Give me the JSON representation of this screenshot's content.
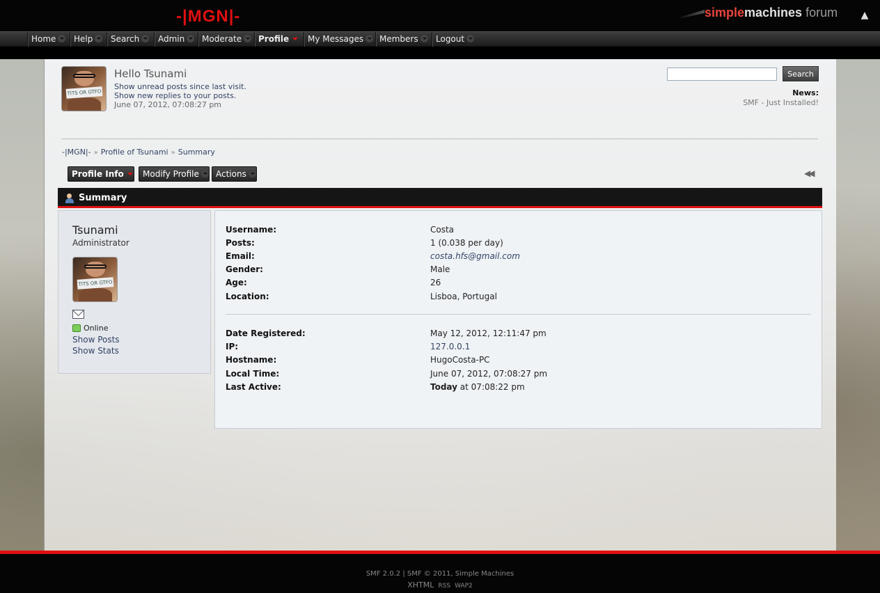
{
  "site": {
    "title": "-|MGN|-"
  },
  "brand": {
    "simple": "simple",
    "machines": "machines",
    "forum": " forum"
  },
  "menu": {
    "items": [
      "Home",
      "Help",
      "Search",
      "Admin",
      "Moderate",
      "Profile",
      "My Messages",
      "Members",
      "Logout"
    ],
    "active": "Profile"
  },
  "user": {
    "hello": "Hello Tsunami",
    "unread": "Show unread posts since last visit.",
    "replies": "Show new replies to your posts.",
    "date": "June 07, 2012, 07:08:27 pm"
  },
  "search": {
    "value": "",
    "button": "Search"
  },
  "news": {
    "label": "News:",
    "text": "SMF - Just Installed!"
  },
  "breadcrumb": [
    "-|MGN|-",
    "Profile of Tsunami",
    "Summary"
  ],
  "tabs": [
    "Profile Info",
    "Modify Profile",
    "Actions"
  ],
  "section": {
    "title": "Summary"
  },
  "profile": {
    "name": "Tsunami",
    "position": "Administrator",
    "avatar_sign": "TITS OR GTFO",
    "online_label": "Online",
    "show_posts": "Show Posts",
    "show_stats": "Show Stats",
    "fields1": [
      {
        "k": "Username:",
        "v": "Costa"
      },
      {
        "k": "Posts:",
        "v": "1 (0.038 per day)"
      },
      {
        "k": "Email:",
        "v": "costa.hfs@gmail.com"
      },
      {
        "k": "Gender:",
        "v": "Male"
      },
      {
        "k": "Age:",
        "v": "26"
      },
      {
        "k": "Location:",
        "v": "Lisboa, Portugal"
      }
    ],
    "fields2": [
      {
        "k": "Date Registered:",
        "v": "May 12, 2012, 12:11:47 pm"
      },
      {
        "k": "IP:",
        "v": "127.0.0.1"
      },
      {
        "k": "Hostname:",
        "v": "HugoCosta-PC"
      },
      {
        "k": "Local Time:",
        "v": "June 07, 2012, 07:08:27 pm"
      },
      {
        "k": "Last Active:",
        "v_bold": "Today",
        "v_rest": " at 07:08:22 pm"
      }
    ]
  },
  "footer": {
    "copy": "SMF 2.0.2 | SMF © 2011, Simple Machines",
    "xhtml": "XHTML",
    "rss": "RSS",
    "wap": "WAP2"
  },
  "colors": {
    "accent": "#e01010",
    "link": "#334466",
    "bar": "#151515"
  }
}
